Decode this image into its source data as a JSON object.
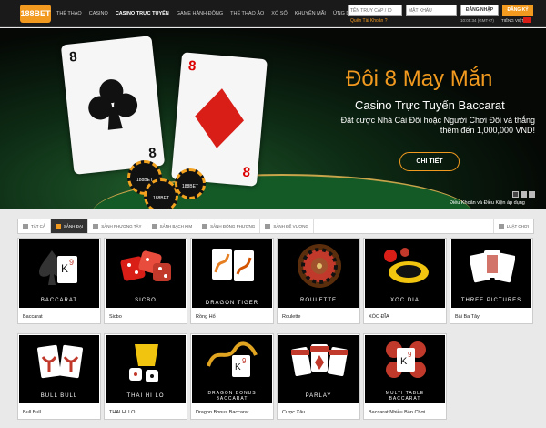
{
  "header": {
    "logo": "188BET",
    "nav": [
      "THỂ THAO",
      "CASINO",
      "CASINO TRỰC TUYẾN",
      "GAME HÀNH ĐỘNG",
      "THỂ THAO ẢO",
      "XỔ SỐ",
      "KHUYẾN MÃI",
      "ỨNG DỤNG"
    ],
    "active_nav": "CASINO TRỰC TUYẾN",
    "username_placeholder": "TÊN TRUY CẬP / ID",
    "password_placeholder": "MẬT KHẨU",
    "login_label": "ĐĂNG NHẬP",
    "register_label": "ĐĂNG KÝ",
    "forgot_label": "Quên Tài Khoản ?",
    "clock": "10:05:34 (GMT+7)",
    "language": "TIẾNG VIỆT"
  },
  "banner": {
    "title": "Đôi 8 May Mắn",
    "subtitle": "Casino Trực Tuyến Baccarat",
    "description": "Đặt cược Nhà Cái Đôi hoặc Người Chơi Đôi và thắng thêm đến 1,000,000 VND!",
    "button_label": "CHI TIẾT",
    "terms_label": "Điều Khoản và Điều Kiện áp dụng",
    "card_rank": "8",
    "chip_text": "188BET"
  },
  "tabs": [
    {
      "label": "TẤT CẢ",
      "icon": "grid-icon",
      "active": false
    },
    {
      "label": "SẢNH ĐẠI",
      "icon": "hall-icon",
      "active": true
    },
    {
      "label": "SẢNH PHƯƠNG TÂY",
      "icon": "star-icon",
      "active": false
    },
    {
      "label": "SẢNH BẠCH KIM",
      "icon": "diamond-icon",
      "active": false
    },
    {
      "label": "SẢNH ĐÔNG PHƯƠNG",
      "icon": "fan-icon",
      "active": false
    },
    {
      "label": "SẢNH ĐẾ VƯƠNG",
      "icon": "crown-icon",
      "active": false
    }
  ],
  "history_label": "LUẬT CHƠI",
  "games": [
    {
      "thumb_text": "BACCARAT",
      "label": "Baccarat",
      "icon": "spade-k9-icon",
      "accent": "#c0392b"
    },
    {
      "thumb_text": "SICBO",
      "label": "Sicbo",
      "icon": "dice-icon",
      "accent": "#d91e18"
    },
    {
      "thumb_text": "DRAGON TIGER",
      "label": "Rồng Hổ",
      "icon": "dragon-card-icon",
      "accent": "#e67e22"
    },
    {
      "thumb_text": "ROULETTE",
      "label": "Roulette",
      "icon": "roulette-wheel-icon",
      "accent": "#c0392b"
    },
    {
      "thumb_text": "XOC DIA",
      "label": "XÓC ĐĨA",
      "icon": "bowl-coins-icon",
      "accent": "#f1c40f"
    },
    {
      "thumb_text": "THREE PICTURES",
      "label": "Bài Ba Tây",
      "icon": "three-cards-icon",
      "accent": "#c0392b"
    },
    {
      "thumb_text": "BULL BULL",
      "label": "Bull Bull",
      "icon": "bull-card-icon",
      "accent": "#c0392b"
    },
    {
      "thumb_text": "THAI HI LO",
      "label": "THAI HI LO",
      "icon": "dice-cup-icon",
      "accent": "#f1c40f"
    },
    {
      "thumb_text": "DRAGON BONUS BACCARAT",
      "label": "Dragon Bonus Baccarat",
      "icon": "golden-dragon-icon",
      "accent": "#e1a421"
    },
    {
      "thumb_text": "PARLAY",
      "label": "Cược Xâu",
      "icon": "win-cards-icon",
      "accent": "#c0392b"
    },
    {
      "thumb_text": "MULTI TABLE BACCARAT",
      "label": "Baccarat Nhiều Bàn Chơi",
      "icon": "multi-chip-icon",
      "accent": "#c0392b"
    }
  ],
  "colors": {
    "brand": "#f29a1f",
    "dark": "#1a1a1a",
    "active_tab": "#333333"
  }
}
